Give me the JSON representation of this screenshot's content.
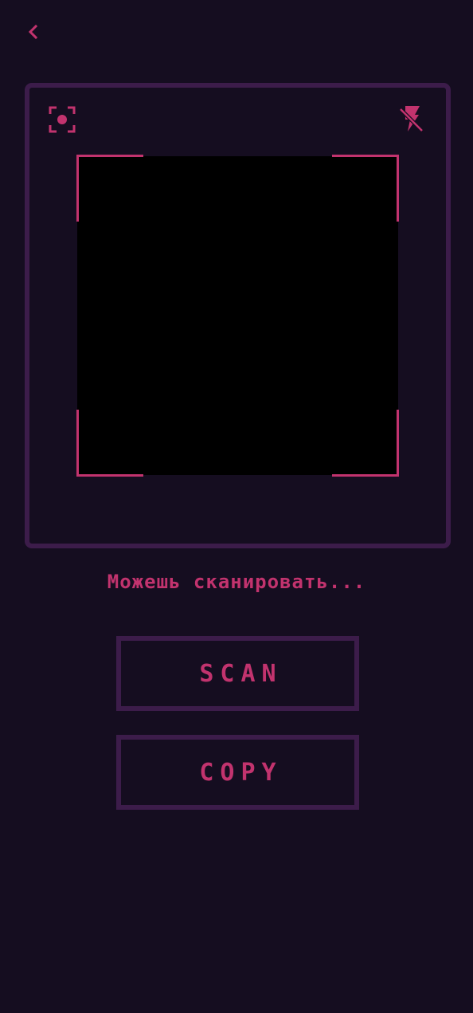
{
  "header": {
    "back_icon": "chevron-left-icon"
  },
  "scanner": {
    "left_icon": "focus-icon",
    "right_icon": "flash-off-icon"
  },
  "status": {
    "text": "Можешь сканировать..."
  },
  "actions": {
    "scan_label": "SCAN",
    "copy_label": "COPY"
  },
  "colors": {
    "background": "#150d20",
    "border": "#3c1c4a",
    "accent": "#c2336e",
    "camera": "#000000"
  }
}
